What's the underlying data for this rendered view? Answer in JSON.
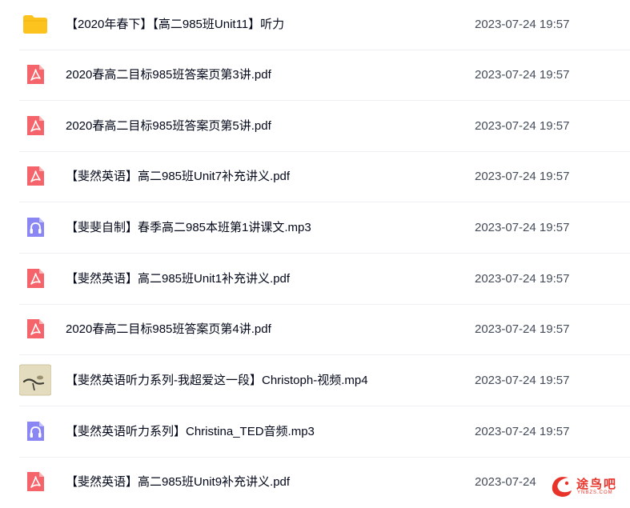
{
  "colors": {
    "folder": "#fcc31f",
    "pdf": "#f5646a",
    "audio": "#8a87f4",
    "text": "#03081a",
    "date": "#454d5a",
    "divider": "#eef0f4",
    "watermark": "#e8332a"
  },
  "files": [
    {
      "icon": "folder-icon",
      "name": "【2020年春下】【高二985班Unit11】听力",
      "date": "2023-07-24 19:57"
    },
    {
      "icon": "pdf-icon",
      "name": "2020春高二目标985班答案页第3讲.pdf",
      "date": "2023-07-24 19:57"
    },
    {
      "icon": "pdf-icon",
      "name": "2020春高二目标985班答案页第5讲.pdf",
      "date": "2023-07-24 19:57"
    },
    {
      "icon": "pdf-icon",
      "name": "【斐然英语】高二985班Unit7补充讲义.pdf",
      "date": "2023-07-24 19:57"
    },
    {
      "icon": "audio-icon",
      "name": "【斐斐自制】春季高二985本班第1讲课文.mp3",
      "date": "2023-07-24 19:57"
    },
    {
      "icon": "pdf-icon",
      "name": "【斐然英语】高二985班Unit1补充讲义.pdf",
      "date": "2023-07-24 19:57"
    },
    {
      "icon": "pdf-icon",
      "name": "2020春高二目标985班答案页第4讲.pdf",
      "date": "2023-07-24 19:57"
    },
    {
      "icon": "video-thumbnail",
      "name": "【斐然英语听力系列-我超爱这一段】Christoph-视频.mp4",
      "date": "2023-07-24 19:57"
    },
    {
      "icon": "audio-icon",
      "name": "【斐然英语听力系列】Christina_TED音频.mp3",
      "date": "2023-07-24 19:57"
    },
    {
      "icon": "pdf-icon",
      "name": "【斐然英语】高二985班Unit9补充讲义.pdf",
      "date": "2023-07-24"
    }
  ],
  "watermark": {
    "text": "途鸟吧",
    "sub": "YNBZS.COM"
  }
}
